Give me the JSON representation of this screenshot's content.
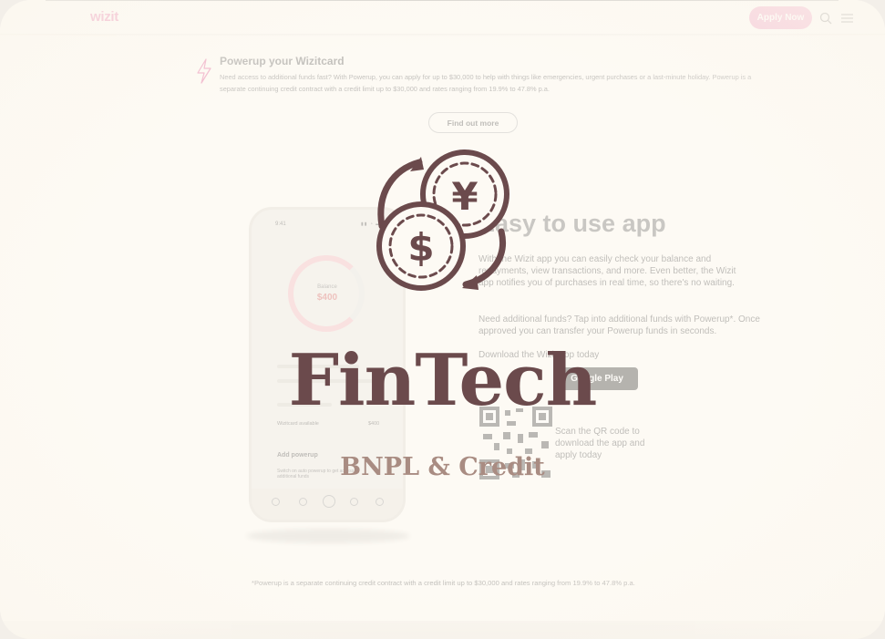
{
  "header": {
    "logo": "wizit",
    "apply_label": "Apply Now"
  },
  "powerup": {
    "title": "Powerup your Wizitcard",
    "text": "Need access to additional funds fast? With Powerup, you can apply for up to $30,000 to help with things like emergencies, urgent purchases or a last-minute holiday. Powerup is a separate continuing credit contract with a credit limit up to $30,000 and rates ranging from 19.9% to 47.8% p.a.",
    "button": "Find out more"
  },
  "phone": {
    "time": "9:41",
    "status": "▮▮ ◔ ▬",
    "balance_label": "Balance",
    "balance_value": "$400",
    "row_label": "Wizitcard available",
    "row_value": "$400",
    "powerup_title": "Add powerup",
    "powerup_text": "Switch on auto powerup to get access to additional funds"
  },
  "app_section": {
    "title": "Easy to use app",
    "text1": "With the Wizit app you can easily check your balance and repayments, view transactions, and more. Even better, the Wizit app notifies you of purchases in real time, so there's no waiting.",
    "text2": "Need additional funds? Tap into additional funds with Powerup*. Once approved you can transfer your Powerup funds in seconds.",
    "download_label": "Download the Wizit app today",
    "gplay_label": "Google Play",
    "qr_text": "Scan the QR code to download the app and apply today"
  },
  "footnote": "*Powerup is a separate continuing credit contract with a credit limit up to $30,000 and rates ranging from 19.9% to 47.8% p.a.",
  "overlay": {
    "title": "FinTech",
    "subtitle": "BNPL & Credit",
    "icon": "currency-exchange-icon"
  },
  "colors": {
    "brand": "#d81b72",
    "accent": "#e8609e",
    "overlay_title": "#6b4a4c",
    "overlay_subtitle": "#a98c82"
  }
}
